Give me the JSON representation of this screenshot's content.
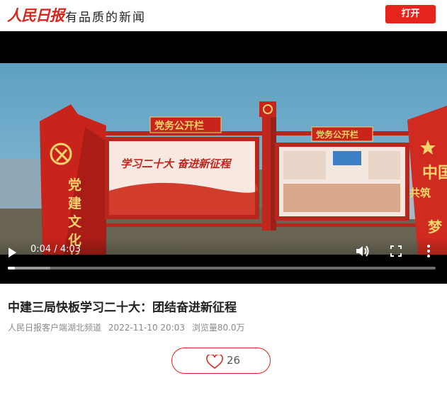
{
  "header": {
    "logo_text": "人民日报",
    "slogan": "有品质的新闻",
    "open_label": "打开"
  },
  "video": {
    "scene_text": {
      "board_left": "党务公开栏",
      "board_right": "党务公开栏",
      "vertical_sign": "党建文化长",
      "banner": "学习二十大 奋进新征程",
      "right_sign_top": "中国",
      "right_sign_side": "共筑",
      "right_sign_bottom": "梦"
    },
    "time_display": "0:04 / 4:03",
    "progress_played": 0.017,
    "progress_buffered": 0.1,
    "icons": [
      "play-icon",
      "volume-icon",
      "fullscreen-icon",
      "more-icon"
    ]
  },
  "article": {
    "title": "中建三局快板学习二十大：团结奋进新征程",
    "source": "人民日报客户端湖北频道",
    "date": "2022-11-10 20:03",
    "views": "浏览量80.0万"
  },
  "like": {
    "count": "26"
  },
  "colors": {
    "brand_red": "#e5251d",
    "sign_red": "#c8241b",
    "gold": "#f3d36b"
  }
}
